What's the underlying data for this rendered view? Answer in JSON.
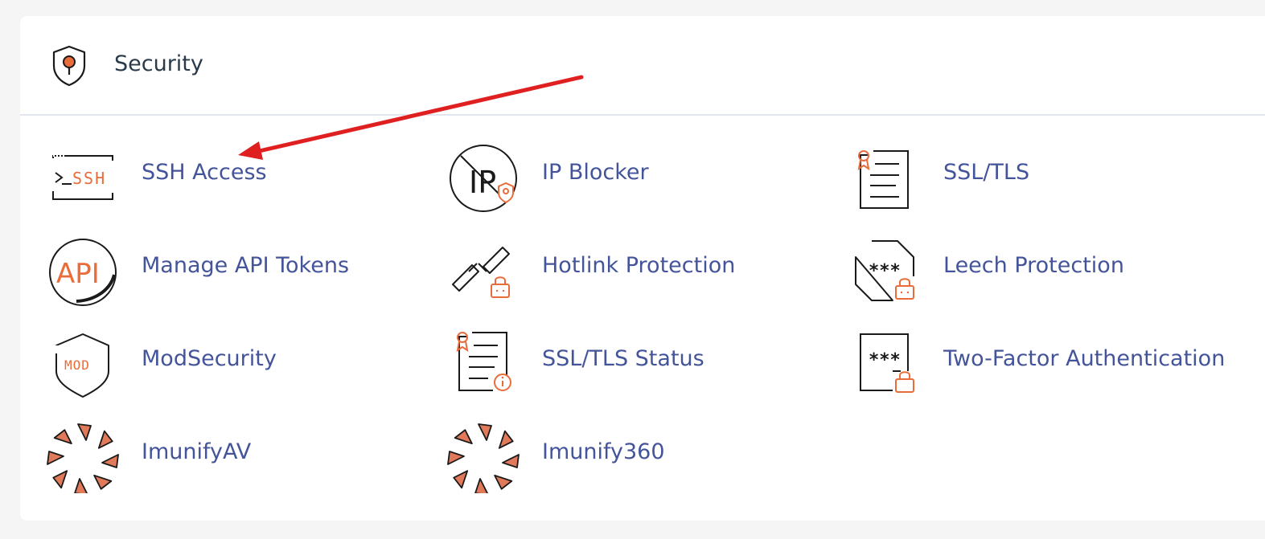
{
  "section": {
    "title": "Security",
    "icon": "shield-pin-icon"
  },
  "colors": {
    "accent": "#e96c3a",
    "link": "#44549a",
    "title": "#293a4a",
    "arrow": "#e02020"
  },
  "items": [
    {
      "label": "SSH Access",
      "icon": "terminal-ssh-icon",
      "ssh_text": "SSH"
    },
    {
      "label": "IP Blocker",
      "icon": "ip-blocker-icon",
      "ip_text": "IP"
    },
    {
      "label": "SSL/TLS",
      "icon": "certificate-icon"
    },
    {
      "label": "Manage API Tokens",
      "icon": "api-token-icon",
      "api_text": "API"
    },
    {
      "label": "Hotlink Protection",
      "icon": "hotlink-lock-icon"
    },
    {
      "label": "Leech Protection",
      "icon": "leech-lock-icon",
      "mask_text": "***"
    },
    {
      "label": "ModSecurity",
      "icon": "mod-shield-icon",
      "mod_text": "MOD"
    },
    {
      "label": "SSL/TLS Status",
      "icon": "certificate-info-icon"
    },
    {
      "label": "Two-Factor Authentication",
      "icon": "two-factor-lock-icon",
      "mask_text": "***"
    },
    {
      "label": "ImunifyAV",
      "icon": "imunify-av-icon"
    },
    {
      "label": "Imunify360",
      "icon": "imunify-360-icon"
    }
  ]
}
